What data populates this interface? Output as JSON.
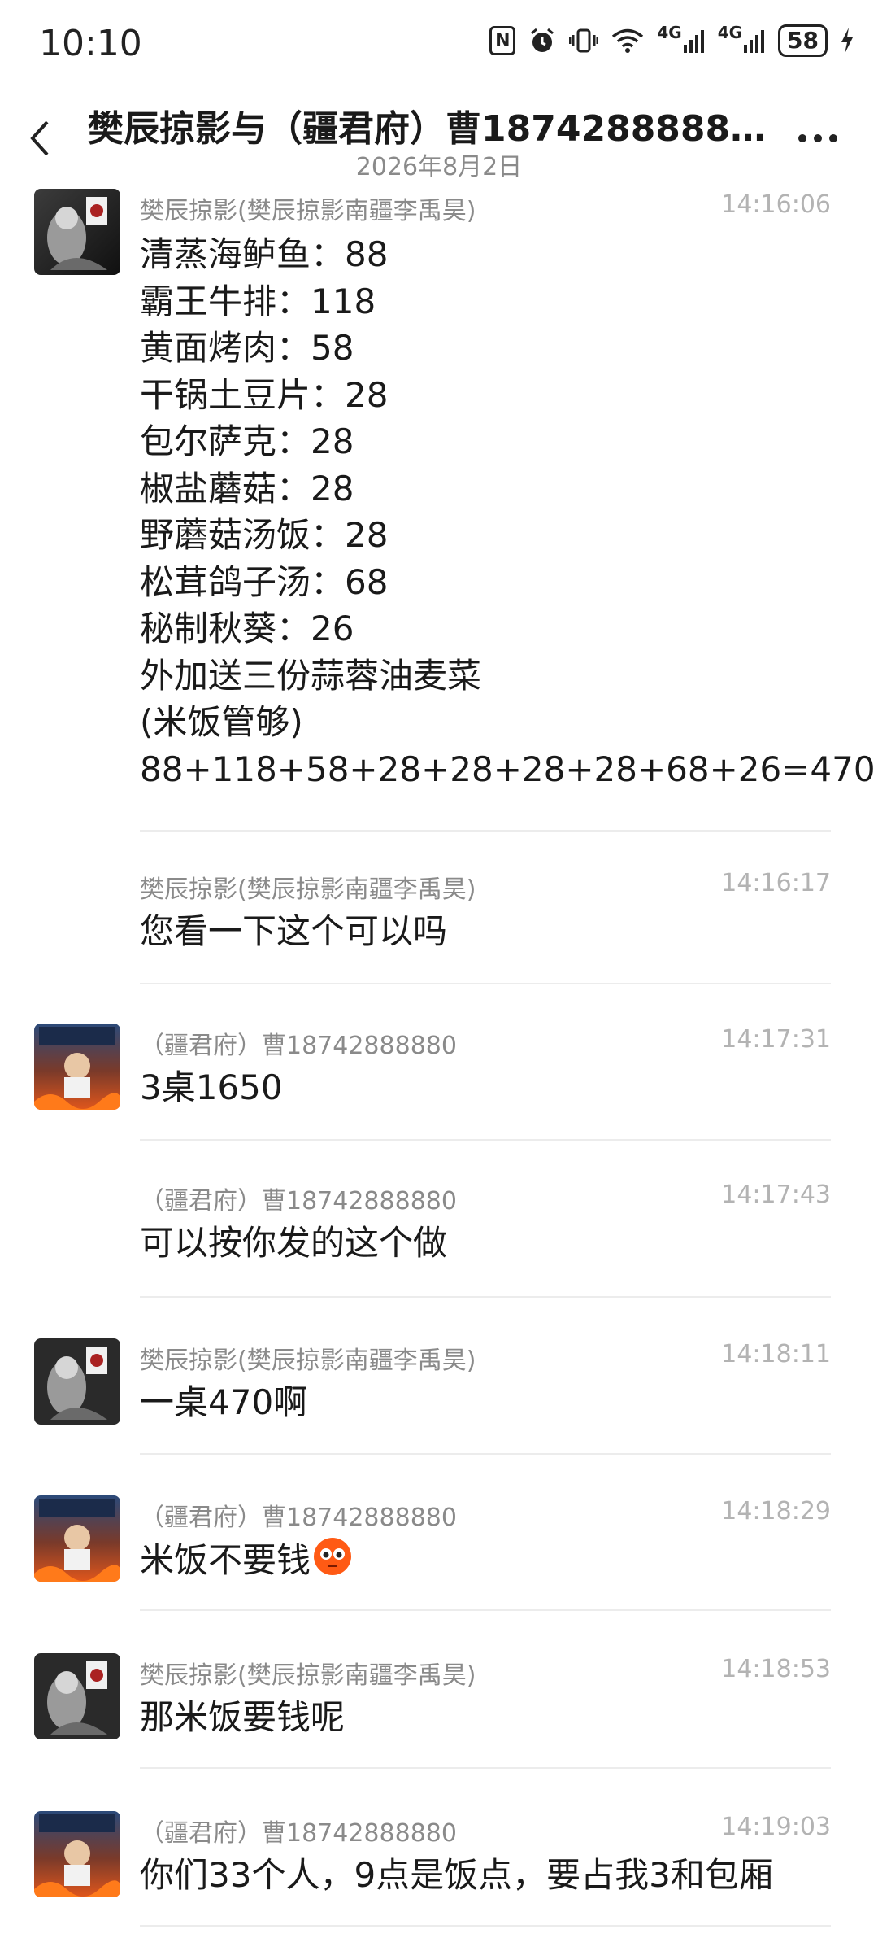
{
  "status_bar": {
    "time": "10:10",
    "nfc": "N",
    "signal_1": "4G",
    "signal_2": "4G",
    "battery": "58"
  },
  "header": {
    "title": "樊辰掠影与（疆君府）曹18742888880...",
    "date": "2026年8月2日"
  },
  "colors": {
    "muted_text": "#8a8a8a",
    "timestamp": "#b3b3b3",
    "divider": "#ececec"
  },
  "messages": [
    {
      "sender": "樊辰掠影(樊辰掠影南疆李禹昊)",
      "time": "14:16:06",
      "lines": [
        "清蒸海鲈鱼：88",
        "霸王牛排：118",
        "黄面烤肉：58",
        "干锅土豆片：28",
        "包尔萨克：28",
        "椒盐蘑菇：28",
        "野蘑菇汤饭：28",
        "松茸鸽子汤：68",
        "秘制秋葵：26",
        "外加送三份蒜蓉油麦菜",
        "(米饭管够)",
        "88+118+58+28+28+28+28+68+26=470"
      ]
    },
    {
      "sender": "樊辰掠影(樊辰掠影南疆李禹昊)",
      "time": "14:16:17",
      "lines": [
        "您看一下这个可以吗"
      ]
    },
    {
      "sender": "（疆君府）曹18742888880",
      "time": "14:17:31",
      "lines": [
        "3桌1650"
      ]
    },
    {
      "sender": "（疆君府）曹18742888880",
      "time": "14:17:43",
      "lines": [
        "可以按你发的这个做"
      ]
    },
    {
      "sender": "樊辰掠影(樊辰掠影南疆李禹昊)",
      "time": "14:18:11",
      "lines": [
        "一桌470啊"
      ]
    },
    {
      "sender": "（疆君府）曹18742888880",
      "time": "14:18:29",
      "lines": [
        "米饭不要钱"
      ]
    },
    {
      "sender": "樊辰掠影(樊辰掠影南疆李禹昊)",
      "time": "14:18:53",
      "lines": [
        "那米饭要钱呢"
      ]
    },
    {
      "sender": "（疆君府）曹18742888880",
      "time": "14:19:03",
      "lines": [
        "你们33个人，9点是饭点，要占我3和包厢"
      ]
    }
  ]
}
